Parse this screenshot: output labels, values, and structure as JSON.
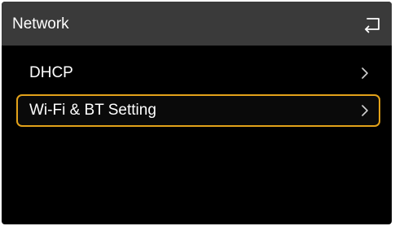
{
  "header": {
    "title": "Network",
    "back_icon": "back-arrow-icon"
  },
  "menu": {
    "items": [
      {
        "label": "DHCP",
        "icon": "chevron-right-icon",
        "selected": false
      },
      {
        "label": "Wi-Fi & BT Setting",
        "icon": "chevron-right-icon",
        "selected": true
      }
    ]
  },
  "colors": {
    "background": "#000000",
    "header_bg": "#3a3a3a",
    "text": "#ffffff",
    "focus_border": "#e3a21a"
  }
}
